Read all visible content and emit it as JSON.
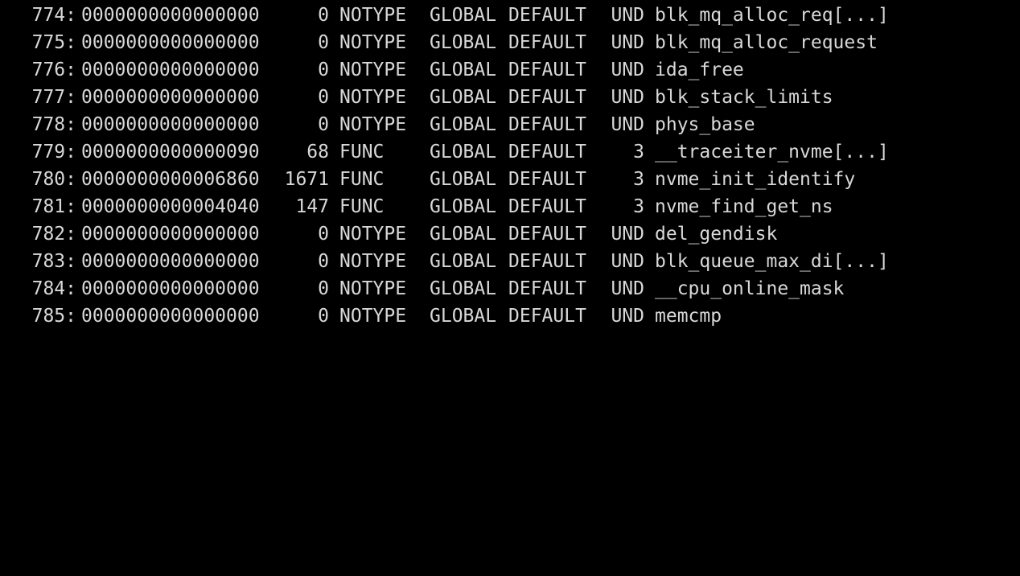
{
  "colors": {
    "background": "#000000",
    "foreground": "#d8d8d8"
  },
  "symbols": [
    {
      "num": "774:",
      "value": "0000000000000000",
      "size": "0",
      "type": "NOTYPE",
      "bind": "GLOBAL",
      "vis": "DEFAULT",
      "ndx": "UND",
      "name": "blk_mq_alloc_req[...]"
    },
    {
      "num": "775:",
      "value": "0000000000000000",
      "size": "0",
      "type": "NOTYPE",
      "bind": "GLOBAL",
      "vis": "DEFAULT",
      "ndx": "UND",
      "name": "blk_mq_alloc_request"
    },
    {
      "num": "776:",
      "value": "0000000000000000",
      "size": "0",
      "type": "NOTYPE",
      "bind": "GLOBAL",
      "vis": "DEFAULT",
      "ndx": "UND",
      "name": "ida_free"
    },
    {
      "num": "777:",
      "value": "0000000000000000",
      "size": "0",
      "type": "NOTYPE",
      "bind": "GLOBAL",
      "vis": "DEFAULT",
      "ndx": "UND",
      "name": "blk_stack_limits"
    },
    {
      "num": "778:",
      "value": "0000000000000000",
      "size": "0",
      "type": "NOTYPE",
      "bind": "GLOBAL",
      "vis": "DEFAULT",
      "ndx": "UND",
      "name": "phys_base"
    },
    {
      "num": "779:",
      "value": "0000000000000090",
      "size": "68",
      "type": "FUNC",
      "bind": "GLOBAL",
      "vis": "DEFAULT",
      "ndx": "3",
      "name": "__traceiter_nvme[...]"
    },
    {
      "num": "780:",
      "value": "0000000000006860",
      "size": "1671",
      "type": "FUNC",
      "bind": "GLOBAL",
      "vis": "DEFAULT",
      "ndx": "3",
      "name": "nvme_init_identify"
    },
    {
      "num": "781:",
      "value": "0000000000004040",
      "size": "147",
      "type": "FUNC",
      "bind": "GLOBAL",
      "vis": "DEFAULT",
      "ndx": "3",
      "name": "nvme_find_get_ns"
    },
    {
      "num": "782:",
      "value": "0000000000000000",
      "size": "0",
      "type": "NOTYPE",
      "bind": "GLOBAL",
      "vis": "DEFAULT",
      "ndx": "UND",
      "name": "del_gendisk"
    },
    {
      "num": "783:",
      "value": "0000000000000000",
      "size": "0",
      "type": "NOTYPE",
      "bind": "GLOBAL",
      "vis": "DEFAULT",
      "ndx": "UND",
      "name": "blk_queue_max_di[...]"
    },
    {
      "num": "784:",
      "value": "0000000000000000",
      "size": "0",
      "type": "NOTYPE",
      "bind": "GLOBAL",
      "vis": "DEFAULT",
      "ndx": "UND",
      "name": "__cpu_online_mask"
    },
    {
      "num": "785:",
      "value": "0000000000000000",
      "size": "0",
      "type": "NOTYPE",
      "bind": "GLOBAL",
      "vis": "DEFAULT",
      "ndx": "UND",
      "name": "memcmp"
    }
  ]
}
